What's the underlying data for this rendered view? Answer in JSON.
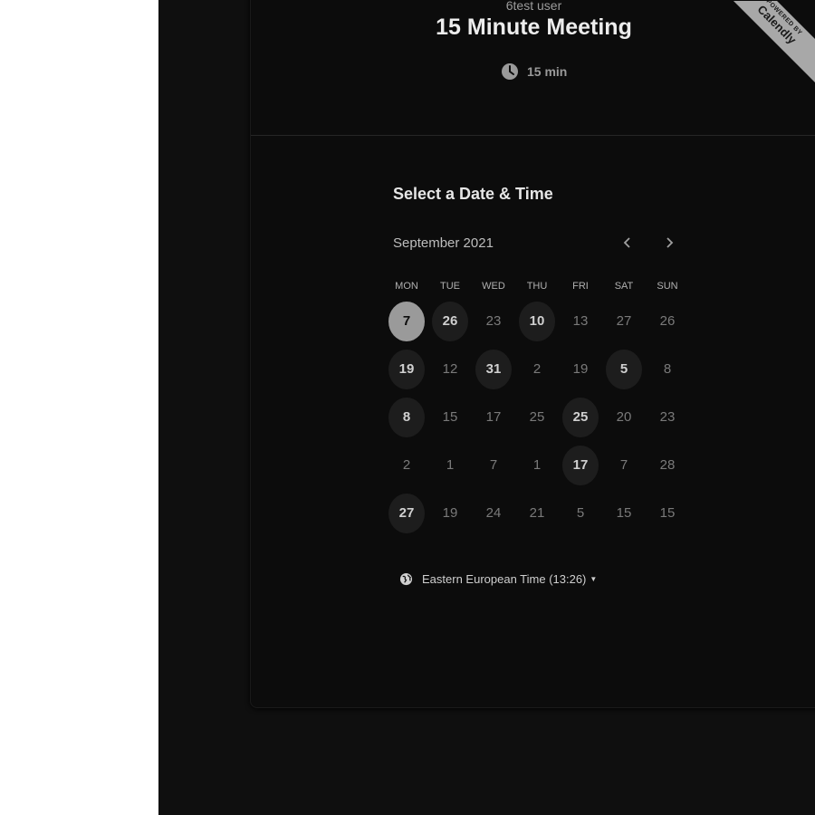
{
  "event": {
    "organizer": "6test user",
    "title": "15 Minute Meeting",
    "duration": "15 min",
    "duration_icon": "clock-icon"
  },
  "badge": {
    "small_text": "POWERED BY",
    "brand": "Calendly",
    "color": "#a8a8a8"
  },
  "scheduler": {
    "heading": "Select a Date & Time",
    "month": "September 2021",
    "prev_icon": "chevron-left-icon",
    "next_icon": "chevron-right-icon",
    "weekdays": [
      "MON",
      "TUE",
      "WED",
      "THU",
      "FRI",
      "SAT",
      "SUN"
    ],
    "days": [
      {
        "label": "7",
        "state": "selected"
      },
      {
        "label": "26",
        "state": "available"
      },
      {
        "label": "23",
        "state": "unavailable"
      },
      {
        "label": "10",
        "state": "available"
      },
      {
        "label": "13",
        "state": "unavailable"
      },
      {
        "label": "27",
        "state": "unavailable"
      },
      {
        "label": "26",
        "state": "unavailable"
      },
      {
        "label": "19",
        "state": "available"
      },
      {
        "label": "12",
        "state": "unavailable"
      },
      {
        "label": "31",
        "state": "available"
      },
      {
        "label": "2",
        "state": "unavailable"
      },
      {
        "label": "19",
        "state": "unavailable"
      },
      {
        "label": "5",
        "state": "available"
      },
      {
        "label": "8",
        "state": "unavailable"
      },
      {
        "label": "8",
        "state": "available"
      },
      {
        "label": "15",
        "state": "unavailable"
      },
      {
        "label": "17",
        "state": "unavailable"
      },
      {
        "label": "25",
        "state": "unavailable"
      },
      {
        "label": "25",
        "state": "available"
      },
      {
        "label": "20",
        "state": "unavailable"
      },
      {
        "label": "23",
        "state": "unavailable"
      },
      {
        "label": "2",
        "state": "unavailable"
      },
      {
        "label": "1",
        "state": "unavailable"
      },
      {
        "label": "7",
        "state": "unavailable"
      },
      {
        "label": "1",
        "state": "unavailable"
      },
      {
        "label": "17",
        "state": "available"
      },
      {
        "label": "7",
        "state": "unavailable"
      },
      {
        "label": "28",
        "state": "unavailable"
      },
      {
        "label": "27",
        "state": "available"
      },
      {
        "label": "19",
        "state": "unavailable"
      },
      {
        "label": "24",
        "state": "unavailable"
      },
      {
        "label": "21",
        "state": "unavailable"
      },
      {
        "label": "5",
        "state": "unavailable"
      },
      {
        "label": "15",
        "state": "unavailable"
      },
      {
        "label": "15",
        "state": "unavailable"
      }
    ],
    "timezone": "Eastern European Time (13:26)",
    "timezone_icon": "globe-icon"
  },
  "colors": {
    "background": "#0c0c0c",
    "available_day": "#1d1d1d",
    "selected_day": "#9a9a9a",
    "page_left": "#ffffff"
  }
}
